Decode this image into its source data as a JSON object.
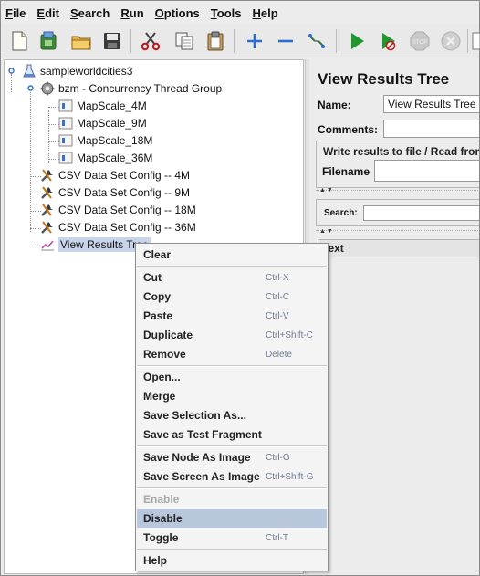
{
  "menubar": {
    "items": [
      {
        "mnemonic": "F",
        "rest": "ile"
      },
      {
        "mnemonic": "E",
        "rest": "dit"
      },
      {
        "mnemonic": "S",
        "rest": "earch"
      },
      {
        "mnemonic": "R",
        "rest": "un"
      },
      {
        "mnemonic": "O",
        "rest": "ptions"
      },
      {
        "mnemonic": "T",
        "rest": "ools"
      },
      {
        "mnemonic": "H",
        "rest": "elp"
      }
    ]
  },
  "tree": {
    "root": "sampleworldcities3",
    "thread_group": "bzm - Concurrency Thread Group",
    "samplers": [
      "MapScale_4M",
      "MapScale_9M",
      "MapScale_18M",
      "MapScale_36M"
    ],
    "configs": [
      "CSV Data Set Config -- 4M",
      "CSV Data Set Config -- 9M",
      "CSV Data Set Config -- 18M",
      "CSV Data Set Config -- 36M"
    ],
    "listener": "View Results Tree"
  },
  "right_panel": {
    "title": "View Results Tree",
    "name_label": "Name:",
    "name_value": "View Results Tree",
    "comments_label": "Comments:",
    "write_results_label": "Write results to file / Read from",
    "filename_label": "Filename",
    "search_label": "Search:",
    "text_tab": "Text"
  },
  "context_menu": {
    "clear": "Clear",
    "cut": "Cut",
    "cut_sc": "Ctrl-X",
    "copy": "Copy",
    "copy_sc": "Ctrl-C",
    "paste": "Paste",
    "paste_sc": "Ctrl-V",
    "duplicate": "Duplicate",
    "duplicate_sc": "Ctrl+Shift-C",
    "remove": "Remove",
    "remove_sc": "Delete",
    "open": "Open...",
    "merge": "Merge",
    "save_selection": "Save Selection As...",
    "save_fragment": "Save as Test Fragment",
    "save_node_image": "Save Node As Image",
    "save_node_image_sc": "Ctrl-G",
    "save_screen_image": "Save Screen As Image",
    "save_screen_image_sc": "Ctrl+Shift-G",
    "enable": "Enable",
    "disable": "Disable",
    "toggle": "Toggle",
    "toggle_sc": "Ctrl-T",
    "help": "Help"
  },
  "toolbar": {
    "icons": [
      "new-icon",
      "templates-icon",
      "open-icon",
      "save-icon",
      "cut-icon",
      "copy-icon",
      "paste-icon",
      "expand-icon",
      "collapse-icon",
      "toggle-icon",
      "start-icon",
      "start-no-timers-icon",
      "stop-icon",
      "shutdown-icon"
    ]
  },
  "colors": {
    "selection": "#c7d4ea",
    "menu_hover": "#b8c7dc",
    "shortcut": "#6f7c96",
    "run_green": "#1d9a2b"
  }
}
